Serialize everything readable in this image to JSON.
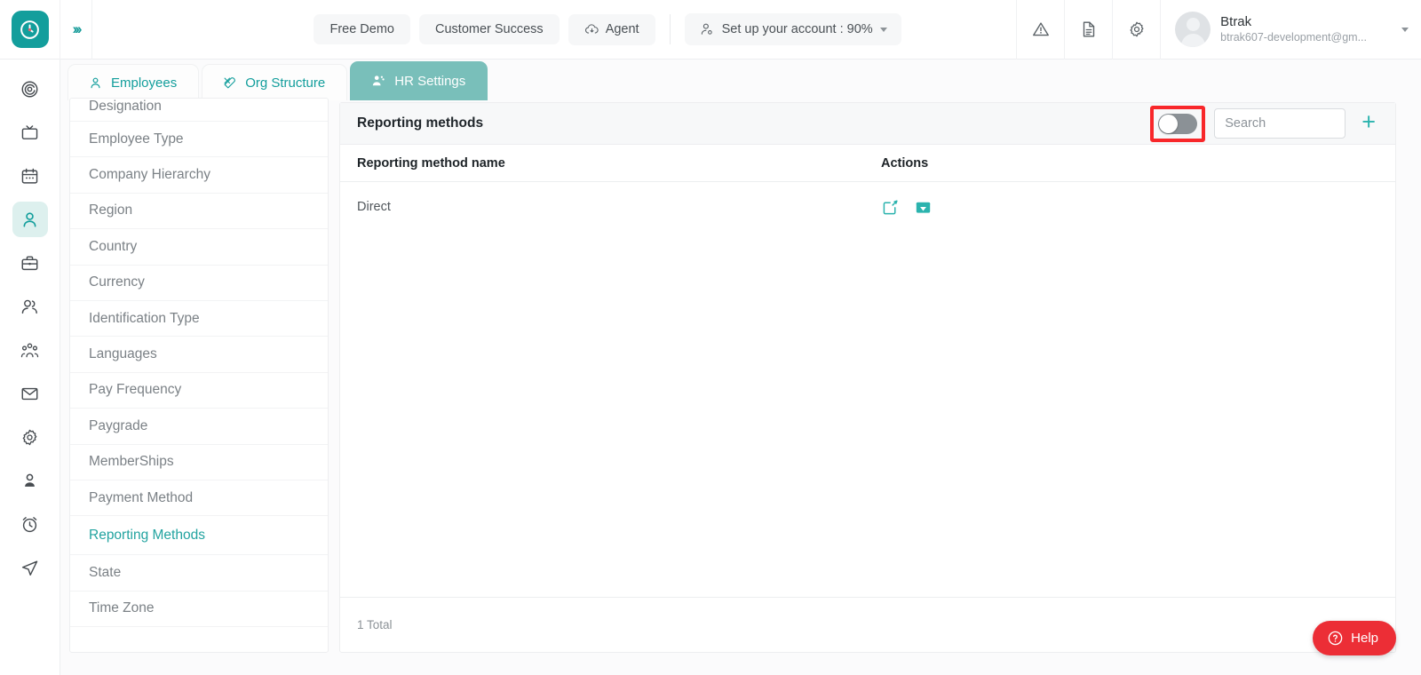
{
  "topbar": {
    "logo_icon": "clock-logo-icon",
    "expand_icon": "chevrons-right-icon",
    "nav_buttons": [
      {
        "label": "Free Demo",
        "icon": null
      },
      {
        "label": "Customer Success",
        "icon": null
      },
      {
        "label": "Agent",
        "icon": "download-cloud-icon"
      }
    ],
    "account_setup": {
      "label": "Set up your account : 90%",
      "icon": "user-gear-icon"
    },
    "right_icons": [
      {
        "name": "warning-triangle-icon"
      },
      {
        "name": "document-icon"
      },
      {
        "name": "gear-icon"
      }
    ],
    "user": {
      "name": "Btrak",
      "email": "btrak607-development@gm..."
    }
  },
  "rail": {
    "items": [
      {
        "name": "target-icon",
        "active": false
      },
      {
        "name": "monitor-icon",
        "active": false
      },
      {
        "name": "calendar-icon",
        "active": false
      },
      {
        "name": "person-icon",
        "active": true
      },
      {
        "name": "briefcase-icon",
        "active": false
      },
      {
        "name": "users-icon",
        "active": false
      },
      {
        "name": "team-group-icon",
        "active": false
      },
      {
        "name": "mail-icon",
        "active": false
      },
      {
        "name": "settings-gear-icon",
        "active": false
      },
      {
        "name": "user-avatar-icon",
        "active": false
      },
      {
        "name": "alarm-clock-icon",
        "active": false
      },
      {
        "name": "send-arrow-icon",
        "active": false
      }
    ]
  },
  "tabs": [
    {
      "label": "Employees",
      "icon": "person-icon",
      "active": false
    },
    {
      "label": "Org Structure",
      "icon": "tools-icon",
      "active": false
    },
    {
      "label": "HR Settings",
      "icon": "users-gear-icon",
      "active": true
    }
  ],
  "sidebar": {
    "items": [
      {
        "label": "Designation",
        "active": false
      },
      {
        "label": "Employee Type",
        "active": false
      },
      {
        "label": "Company Hierarchy",
        "active": false
      },
      {
        "label": "Region",
        "active": false
      },
      {
        "label": "Country",
        "active": false
      },
      {
        "label": "Currency",
        "active": false
      },
      {
        "label": "Identification Type",
        "active": false
      },
      {
        "label": "Languages",
        "active": false
      },
      {
        "label": "Pay Frequency",
        "active": false
      },
      {
        "label": "Paygrade",
        "active": false
      },
      {
        "label": "MemberShips",
        "active": false
      },
      {
        "label": "Payment Method",
        "active": false
      },
      {
        "label": "Reporting Methods",
        "active": true
      },
      {
        "label": "State",
        "active": false
      },
      {
        "label": "Time Zone",
        "active": false
      }
    ]
  },
  "panel": {
    "title": "Reporting methods",
    "toggle": {
      "name": "archived-toggle",
      "state": "off",
      "highlighted": true
    },
    "search": {
      "placeholder": "Search",
      "value": ""
    },
    "add_button": {
      "label": "+",
      "icon": "plus-icon"
    },
    "columns": [
      "Reporting method name",
      "Actions"
    ],
    "rows": [
      {
        "name": "Direct",
        "actions": [
          "edit-icon",
          "archive-icon"
        ]
      }
    ],
    "footer_total": "1 Total"
  },
  "help": {
    "label": "Help",
    "icon": "question-circle-icon"
  },
  "colors": {
    "accent_teal": "#139e9c",
    "tab_active": "#79bfba",
    "highlight_red": "#f8272a",
    "help_red": "#ec2e36",
    "action_teal": "#2bb3ae"
  }
}
